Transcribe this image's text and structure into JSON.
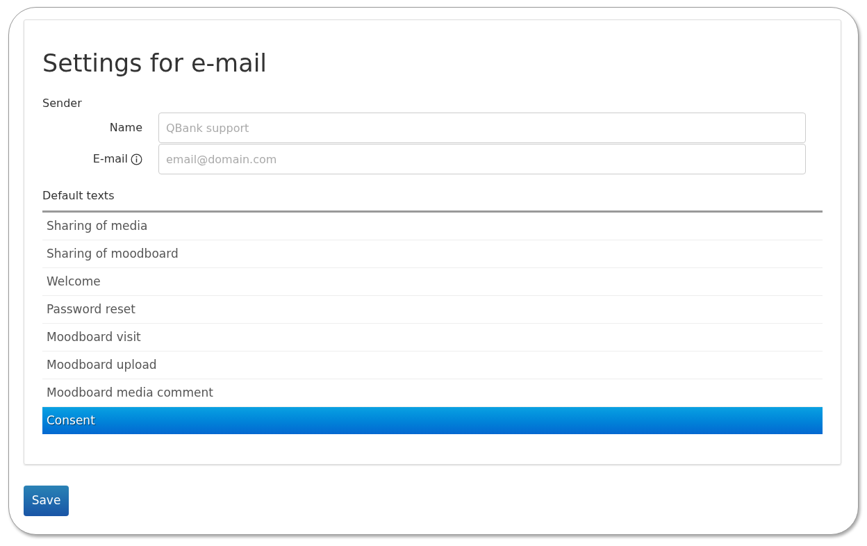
{
  "title": "Settings for e-mail",
  "sender": {
    "heading": "Sender",
    "fields": [
      {
        "label": "Name",
        "info": false,
        "placeholder": "QBank support"
      },
      {
        "label": "E-mail",
        "info": true,
        "placeholder": "email@domain.com"
      }
    ]
  },
  "default_texts": {
    "heading": "Default texts",
    "items": [
      {
        "label": "Sharing of media",
        "selected": false
      },
      {
        "label": "Sharing of moodboard",
        "selected": false
      },
      {
        "label": "Welcome",
        "selected": false
      },
      {
        "label": "Password reset",
        "selected": false
      },
      {
        "label": "Moodboard visit",
        "selected": false
      },
      {
        "label": "Moodboard upload",
        "selected": false
      },
      {
        "label": "Moodboard media comment",
        "selected": false
      },
      {
        "label": "Consent",
        "selected": true
      }
    ]
  },
  "save_button": "Save"
}
